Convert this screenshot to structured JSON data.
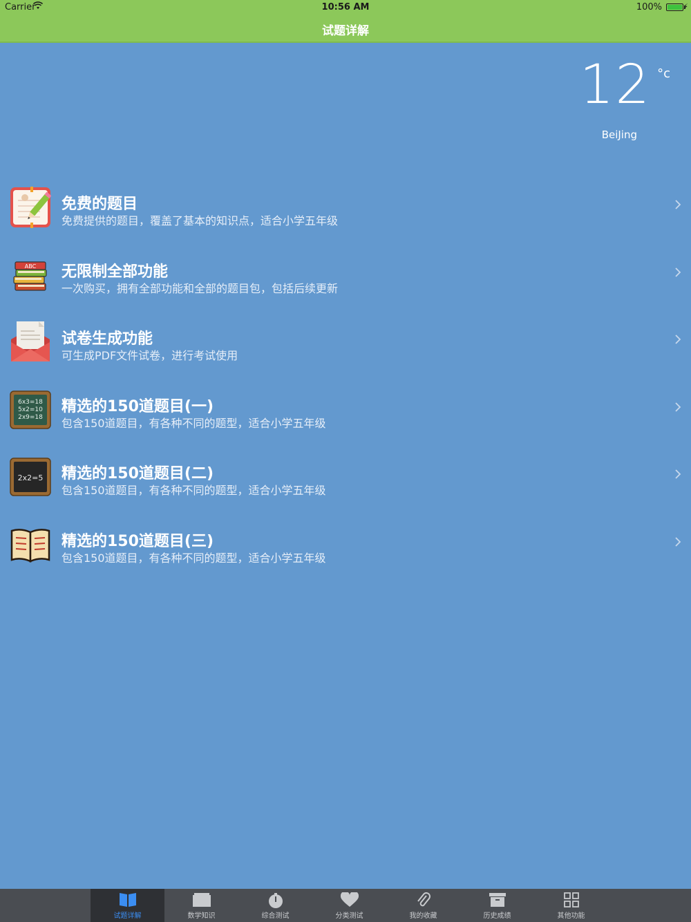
{
  "status": {
    "carrier": "Carrier",
    "time": "10:56 AM",
    "battery": "100%"
  },
  "nav": {
    "title": "试题详解"
  },
  "weather": {
    "temperature": "12",
    "unit": "°c",
    "city": "BeiJing"
  },
  "list": [
    {
      "title": "免费的题目",
      "desc": "免费提供的题目，覆盖了基本的知识点，适合小学五年级",
      "icon": "notebook-pencil-icon"
    },
    {
      "title": "无限制全部功能",
      "desc": "一次购买，拥有全部功能和全部的题目包，包括后续更新",
      "icon": "book-stack-icon"
    },
    {
      "title": "试卷生成功能",
      "desc": "可生成PDF文件试卷，进行考试使用",
      "icon": "envelope-letter-icon"
    },
    {
      "title": "精选的150道题目(一)",
      "desc": "包含150道题目，有各种不同的题型，适合小学五年级",
      "icon": "green-chalkboard-icon",
      "board": [
        "6x3=18",
        "5x2=10",
        "2x9=18"
      ]
    },
    {
      "title": "精选的150道题目(二)",
      "desc": "包含150道题目，有各种不同的题型，适合小学五年级",
      "icon": "black-chalkboard-icon",
      "board": [
        "2x2=5"
      ]
    },
    {
      "title": "精选的150道题目(三)",
      "desc": "包含150道题目，有各种不同的题型，适合小学五年级",
      "icon": "open-book-icon"
    }
  ],
  "tabs": [
    {
      "label": "试题详解",
      "icon": "book-icon",
      "active": true
    },
    {
      "label": "数学知识",
      "icon": "folder-icon"
    },
    {
      "label": "综合测试",
      "icon": "stopwatch-icon"
    },
    {
      "label": "分类测试",
      "icon": "heart-icon"
    },
    {
      "label": "我的收藏",
      "icon": "paperclip-icon"
    },
    {
      "label": "历史成绩",
      "icon": "archive-box-icon"
    },
    {
      "label": "其他功能",
      "icon": "grid-icon"
    }
  ],
  "colors": {
    "navbar": "#8cc85a",
    "background": "#6399cf",
    "tabbar": "#4a4d52",
    "tab_active": "#3b8ef3"
  }
}
